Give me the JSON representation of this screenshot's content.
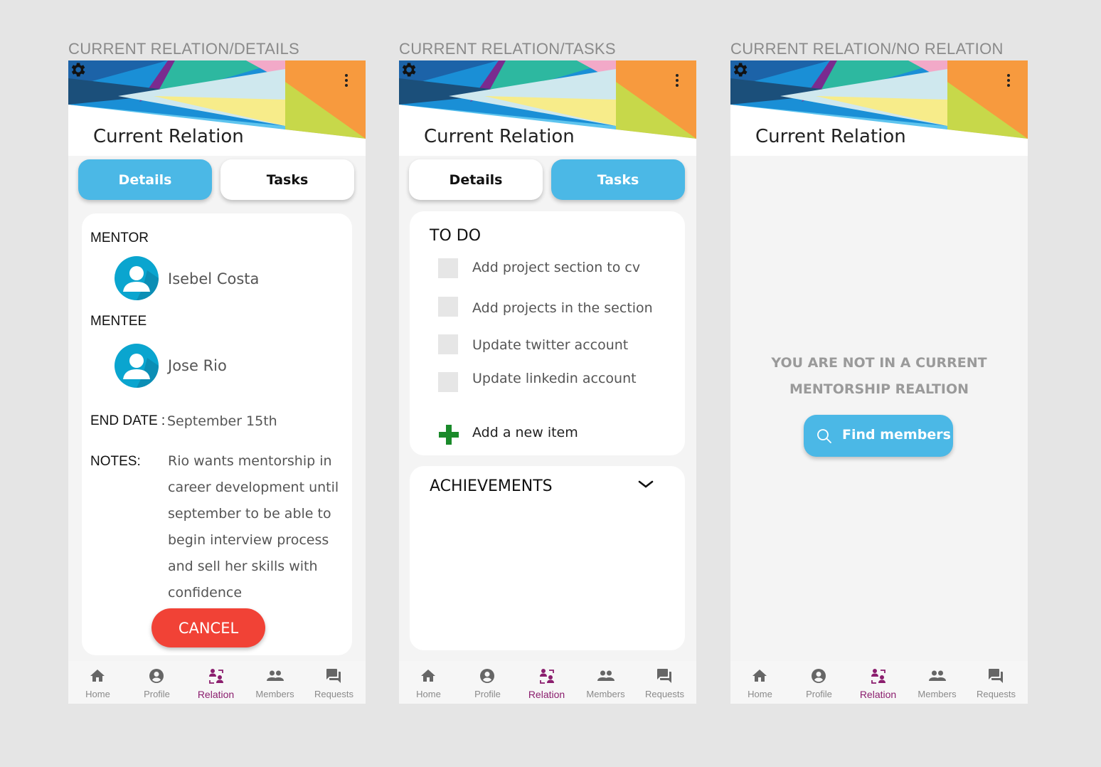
{
  "frames": [
    {
      "label": "CURRENT RELATION/DETAILS"
    },
    {
      "label": "CURRENT RELATION/TASKS"
    },
    {
      "label": "CURRENT RELATION/NO RELATION"
    }
  ],
  "header": {
    "title": "Current Relation",
    "settings_icon": "gear-icon",
    "menu_icon": "kebab-menu-icon"
  },
  "tabs": {
    "details": "Details",
    "tasks": "Tasks"
  },
  "details": {
    "mentor_label": "MENTOR",
    "mentor_name": "Isebel Costa",
    "mentee_label": "MENTEE",
    "mentee_name": "Jose Rio",
    "end_date_label": "END DATE :",
    "end_date_value": "September 15th",
    "notes_label": "NOTES:",
    "notes_value": "Rio wants mentorship in career development until september to be able to begin interview process and sell her skills with confidence",
    "cancel_label": "CANCEL"
  },
  "tasks": {
    "todo_title": "TO DO",
    "items": [
      {
        "label": "Add project section to cv",
        "checked": false
      },
      {
        "label": "Add projects in the section",
        "checked": false
      },
      {
        "label": "Update twitter account",
        "checked": false
      },
      {
        "label": "Update linkedin account",
        "checked": false
      }
    ],
    "add_item_label": "Add a new item",
    "achievements_title": "ACHIEVEMENTS"
  },
  "no_relation": {
    "message_line1": "YOU ARE NOT IN A CURRENT",
    "message_line2": "MENTORSHIP REALTION",
    "find_button": "Find members"
  },
  "nav": {
    "items": [
      {
        "label": "Home",
        "icon": "home-icon"
      },
      {
        "label": "Profile",
        "icon": "profile-icon"
      },
      {
        "label": "Relation",
        "icon": "relation-icon"
      },
      {
        "label": "Members",
        "icon": "members-icon"
      },
      {
        "label": "Requests",
        "icon": "requests-icon"
      }
    ],
    "active": "Relation"
  },
  "colors": {
    "accent": "#4bb8e6",
    "cancel": "#f14236",
    "nav_active": "#8b1e6e",
    "add_icon": "#1a8a2a"
  }
}
